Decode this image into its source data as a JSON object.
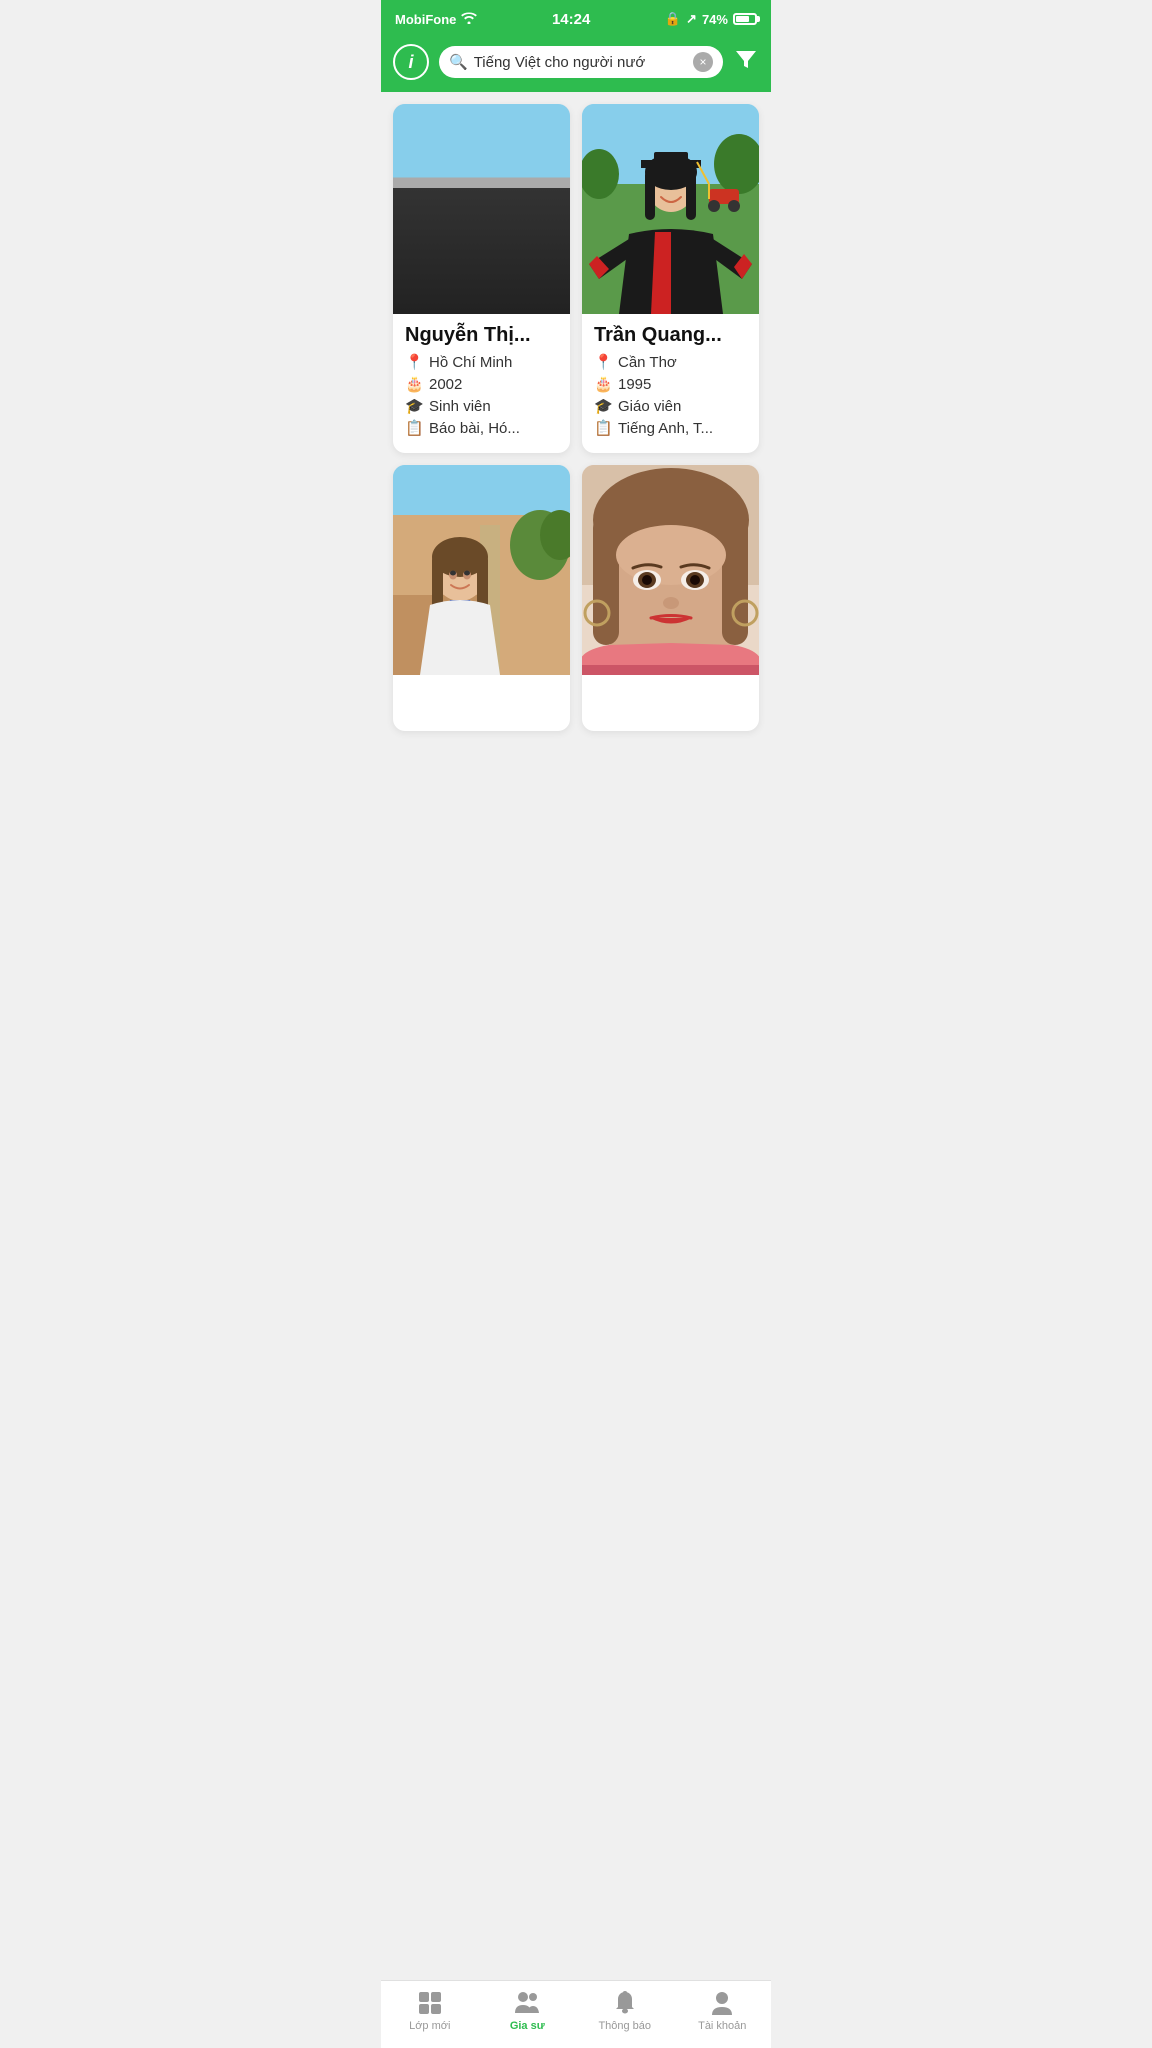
{
  "statusBar": {
    "carrier": "MobiFone",
    "time": "14:24",
    "battery": "74%"
  },
  "header": {
    "info_label": "i",
    "search_text": "Tiếng Việt cho người nướ",
    "search_placeholder": "Tiếng Việt cho người nướ",
    "clear_icon": "×",
    "filter_icon": "⧩"
  },
  "tutors": [
    {
      "id": 1,
      "name": "Nguyễn Thị...",
      "location": "Hồ Chí Minh",
      "year": "2002",
      "role": "Sinh viên",
      "subjects": "Báo bài, Hó...",
      "photo_bg": "photo-1",
      "skin": "#e8c4a0",
      "hair": "#1a1a1a",
      "shirt": "#2a2a2a"
    },
    {
      "id": 2,
      "name": "Trần Quang...",
      "location": "Cần Thơ",
      "year": "1995",
      "role": "Giáo viên",
      "subjects": "Tiếng Anh, T...",
      "photo_bg": "photo-2",
      "skin": "#e8c4a0",
      "hair": "#1a1a1a",
      "gown": "#1a1a1a",
      "gown_accent": "#cc2222"
    },
    {
      "id": 3,
      "name": "...",
      "location": "",
      "year": "",
      "role": "",
      "subjects": "",
      "photo_bg": "photo-3",
      "skin": "#e8c4a0",
      "hair": "#4a3020",
      "shirt": "#f0f0f0"
    },
    {
      "id": 4,
      "name": "...",
      "location": "",
      "year": "",
      "role": "",
      "subjects": "",
      "photo_bg": "photo-4",
      "skin": "#d4a888",
      "hair": "#8a6040",
      "shirt": "#e87880"
    }
  ],
  "tabs": [
    {
      "id": "lop-moi",
      "label": "Lớp mới",
      "icon": "grid",
      "active": false
    },
    {
      "id": "gia-su",
      "label": "Gia sư",
      "icon": "people",
      "active": true
    },
    {
      "id": "thong-bao",
      "label": "Thông báo",
      "icon": "bell",
      "active": false
    },
    {
      "id": "tai-khoan",
      "label": "Tài khoản",
      "icon": "person",
      "active": false
    }
  ],
  "icons": {
    "location": "📍",
    "year": "🎂",
    "role": "🎓",
    "subject": "📋"
  }
}
